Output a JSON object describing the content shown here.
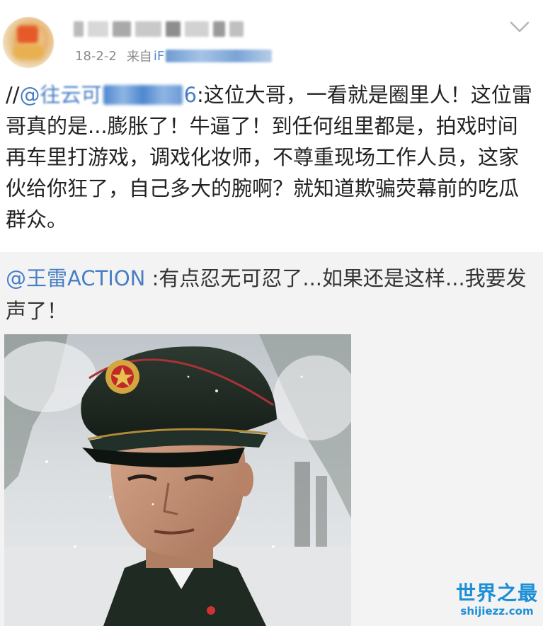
{
  "post": {
    "date": "18-2-2",
    "source_prefix": "来自 ",
    "source_visible": "iF",
    "text_prefix": "//",
    "mention_prefix": "@",
    "mention_visible_start": "往云可",
    "mention_visible_end": "6",
    "text_body": ":这位大哥，一看就是圈里人！这位雷哥真的是...膨胀了！牛逼了！到任何组里都是，拍戏时间再车里打游戏，调戏化妆师，不尊重现场工作人员，这家伙给你狂了，自己多大的腕啊？就知道欺骗荧幕前的吃瓜群众。"
  },
  "retweet": {
    "mention": "@王雷ACTION",
    "text": " :有点忍无可忍了...如果还是这样...我要发声了！"
  },
  "watermark": {
    "title": "世界之最",
    "url": "shijiezz.com"
  },
  "colors": {
    "link": "#4a7ec4",
    "meta": "#8a8a8a",
    "retweet_bg": "#f3f3f3",
    "watermark": "#1c8fd6"
  }
}
